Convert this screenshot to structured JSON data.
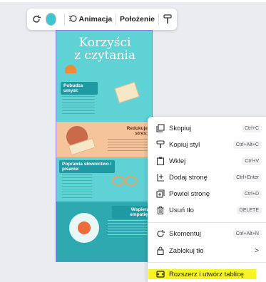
{
  "toolbar": {
    "animation_label": "Animacja",
    "position_label": "Położenie",
    "color_swatch": "#3cc6cf"
  },
  "poster": {
    "title_line1": "Korzyści",
    "title_line2": "z czytania",
    "section1": "Pobudza umysł:",
    "section2": "Redukuje stres:",
    "section3": "Poprawia słownictwo i pisanie:",
    "section4": "Wspiera empatię:",
    "bg_color": "#5fd2d6"
  },
  "menu": {
    "items": [
      {
        "label": "Skopiuj",
        "shortcut": "Ctrl+C",
        "icon": "copy-icon"
      },
      {
        "label": "Kopiuj styl",
        "shortcut": "Ctrl+Alt+C",
        "icon": "paint-roller-icon"
      },
      {
        "label": "Wklej",
        "shortcut": "Ctrl+V",
        "icon": "clipboard-icon"
      },
      {
        "label": "Dodaj stronę",
        "shortcut": "Ctrl+Enter",
        "icon": "add-page-icon"
      },
      {
        "label": "Powiel stronę",
        "shortcut": "Ctrl+D",
        "icon": "duplicate-icon"
      },
      {
        "label": "Usuń tło",
        "shortcut": "DELETE",
        "icon": "trash-icon"
      },
      {
        "label": "Skomentuj",
        "shortcut": "Ctrl+Alt+N",
        "icon": "comment-icon"
      },
      {
        "label": "Zablokuj tło",
        "shortcut": ">",
        "icon": "lock-icon"
      },
      {
        "label": "Rozszerz i utwórz tablicę",
        "icon": "expand-whiteboard-icon"
      }
    ]
  }
}
